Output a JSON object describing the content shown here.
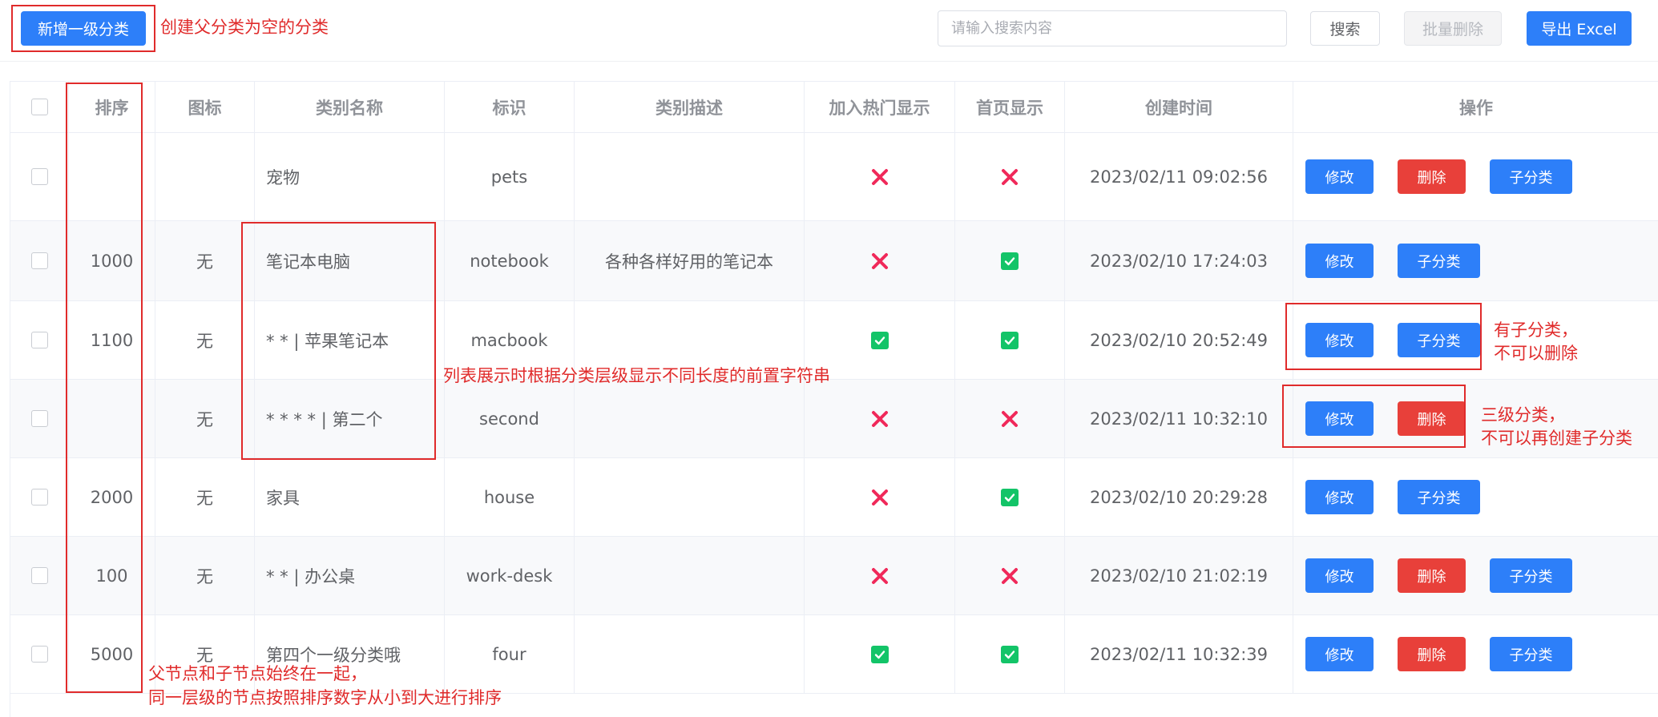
{
  "toolbar": {
    "add_root_label": "新增一级分类",
    "search_placeholder": "请输入搜索内容",
    "search_label": "搜索",
    "batch_delete_label": "批量删除",
    "export_label": "导出 Excel"
  },
  "table": {
    "headers": {
      "sort": "排序",
      "icon": "图标",
      "name": "类别名称",
      "key": "标识",
      "desc": "类别描述",
      "hot": "加入热门显示",
      "home": "首页显示",
      "created": "创建时间",
      "ops": "操作"
    },
    "op_labels": {
      "edit": "修改",
      "delete": "删除",
      "sub": "子分类"
    },
    "rows": [
      {
        "sort": "",
        "icon": "",
        "name": "宠物",
        "key": "pets",
        "desc": "",
        "hot": false,
        "home": false,
        "created": "2023/02/11 09:02:56",
        "ops": [
          "edit",
          "delete",
          "sub"
        ]
      },
      {
        "sort": "1000",
        "icon": "无",
        "name": "笔记本电脑",
        "key": "notebook",
        "desc": "各种各样好用的笔记本",
        "hot": false,
        "home": true,
        "created": "2023/02/10 17:24:03",
        "ops": [
          "edit",
          "sub"
        ]
      },
      {
        "sort": "1100",
        "icon": "无",
        "name": "* * | 苹果笔记本",
        "key": "macbook",
        "desc": "",
        "hot": true,
        "home": true,
        "created": "2023/02/10 20:52:49",
        "ops": [
          "edit",
          "sub"
        ]
      },
      {
        "sort": "",
        "icon": "无",
        "name": "* * * * | 第二个",
        "key": "second",
        "desc": "",
        "hot": false,
        "home": false,
        "created": "2023/02/11 10:32:10",
        "ops": [
          "edit",
          "delete"
        ]
      },
      {
        "sort": "2000",
        "icon": "无",
        "name": "家具",
        "key": "house",
        "desc": "",
        "hot": false,
        "home": true,
        "created": "2023/02/10 20:29:28",
        "ops": [
          "edit",
          "sub"
        ]
      },
      {
        "sort": "100",
        "icon": "无",
        "name": "* * | 办公桌",
        "key": "work-desk",
        "desc": "",
        "hot": false,
        "home": false,
        "created": "2023/02/10 21:02:19",
        "ops": [
          "edit",
          "delete",
          "sub"
        ]
      },
      {
        "sort": "5000",
        "icon": "无",
        "name": "第四个一级分类哦",
        "key": "four",
        "desc": "",
        "hot": true,
        "home": true,
        "created": "2023/02/11 10:32:39",
        "ops": [
          "edit",
          "delete",
          "sub"
        ]
      }
    ]
  },
  "icons": {
    "false_icon": "red-cross-icon",
    "true_icon": "green-check-icon"
  },
  "colors": {
    "primary": "#2d7ff9",
    "danger": "#e8403a",
    "success": "#13c468",
    "cross": "#f0295a",
    "annotation": "#e02b2b"
  },
  "annotations": {
    "add_root": "创建父分类为空的分类",
    "prefix": "列表展示时根据分类层级显示不同长度的前置字符串",
    "has_children": [
      "有子分类，",
      "不可以删除"
    ],
    "level3": [
      "三级分类，",
      "不可以再创建子分类"
    ],
    "sorting": [
      "父节点和子节点始终在一起，",
      "同一层级的节点按照排序数字从小到大进行排序"
    ]
  }
}
